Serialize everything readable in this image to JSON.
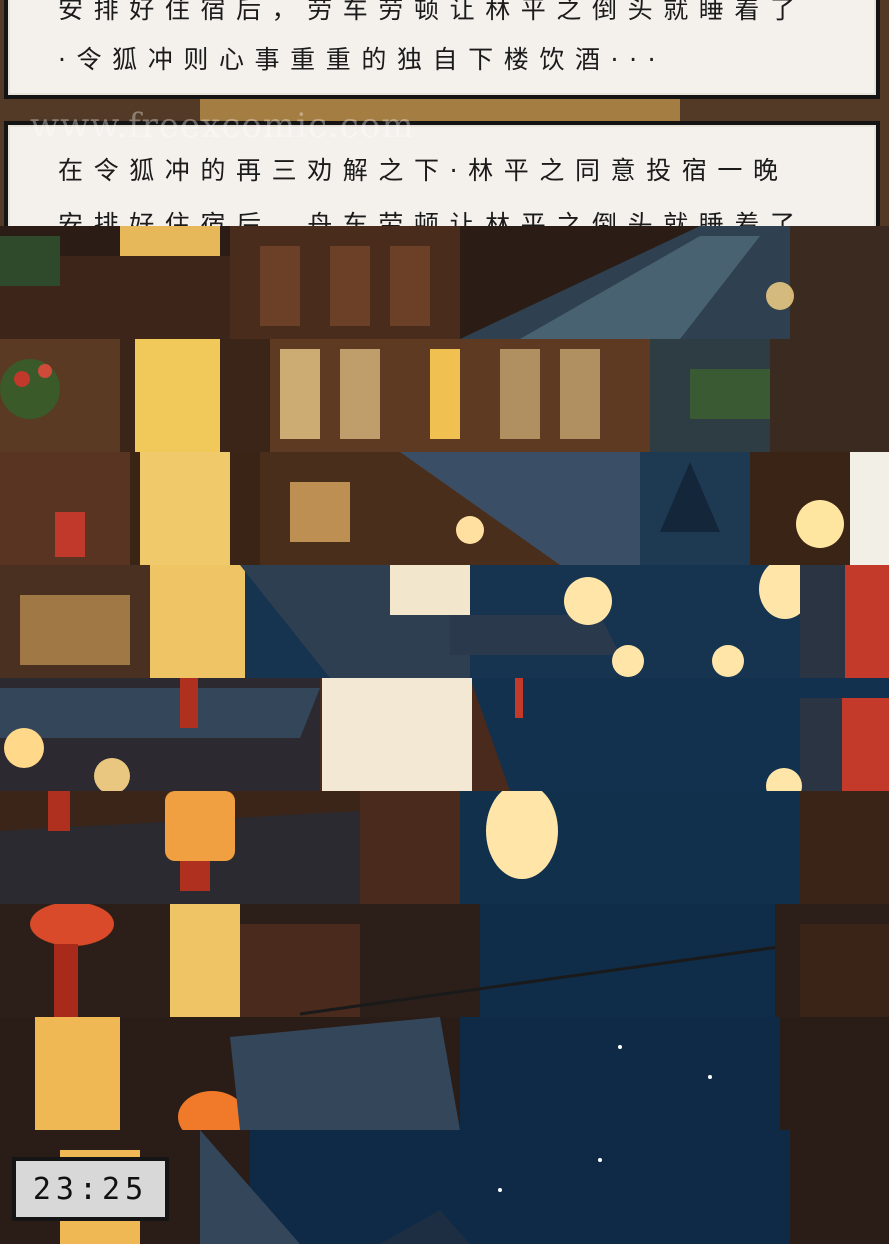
{
  "panel_top": {
    "line1": "安排好住宿后，劳车劳顿让林平之倒头就睡着了",
    "line2": "·令狐冲则心事重重的独自下楼饮酒···"
  },
  "panel_second": {
    "line1": "在令狐冲的再三劝解之下·林平之同意投宿一晚",
    "line2": "安排好住宿后，舟车劳顿让林平之倒头就睡着了"
  },
  "watermark": "www.freexcomic.com",
  "clock": {
    "time": "23:25"
  },
  "colors": {
    "night_sky": "#123552",
    "wood": "#4a2a1e",
    "lantern_glow": "#ffd88a",
    "panel_bg": "#f4f1ec"
  }
}
